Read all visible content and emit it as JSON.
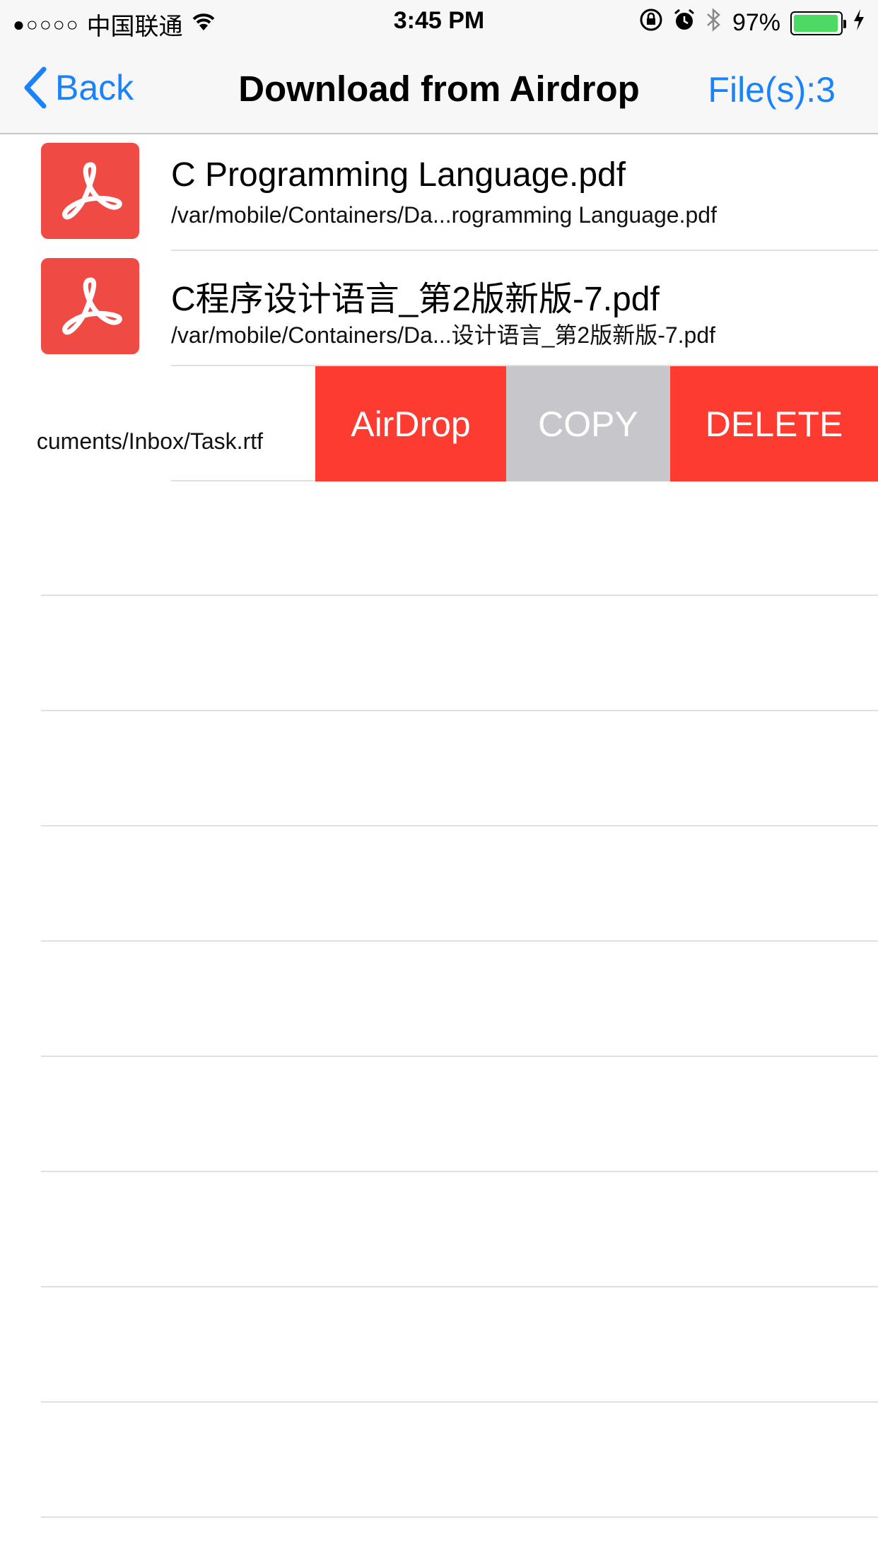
{
  "status_bar": {
    "signal": "●○○○○",
    "carrier": "中国联通",
    "time": "3:45 PM",
    "battery_percent": "97%",
    "battery_level": 0.97,
    "icons": [
      "wifi-icon",
      "orientation-lock-icon",
      "alarm-icon",
      "bluetooth-icon",
      "charging-icon"
    ]
  },
  "nav": {
    "back_label": "Back",
    "title": "Download from Airdrop",
    "file_count": "File(s):3"
  },
  "files": [
    {
      "name": "C Programming Language.pdf",
      "path": "/var/mobile/Containers/Da...rogramming Language.pdf",
      "icon": "pdf-icon"
    },
    {
      "name": "C程序设计语言_第2版新版-7.pdf",
      "path": "/var/mobile/Containers/Da...设计语言_第2版新版-7.pdf",
      "icon": "pdf-icon"
    }
  ],
  "swiped_row": {
    "path_fragment": "cuments/Inbox/Task.rtf",
    "actions": {
      "airdrop": "AirDrop",
      "copy": "COPY",
      "delete": "DELETE"
    }
  },
  "colors": {
    "accent": "#1a82fb",
    "pdf_icon_bg": "#f04a44",
    "delete_red": "#fe3b30",
    "copy_gray": "#c6c6cb",
    "battery_green": "#4cd964"
  }
}
